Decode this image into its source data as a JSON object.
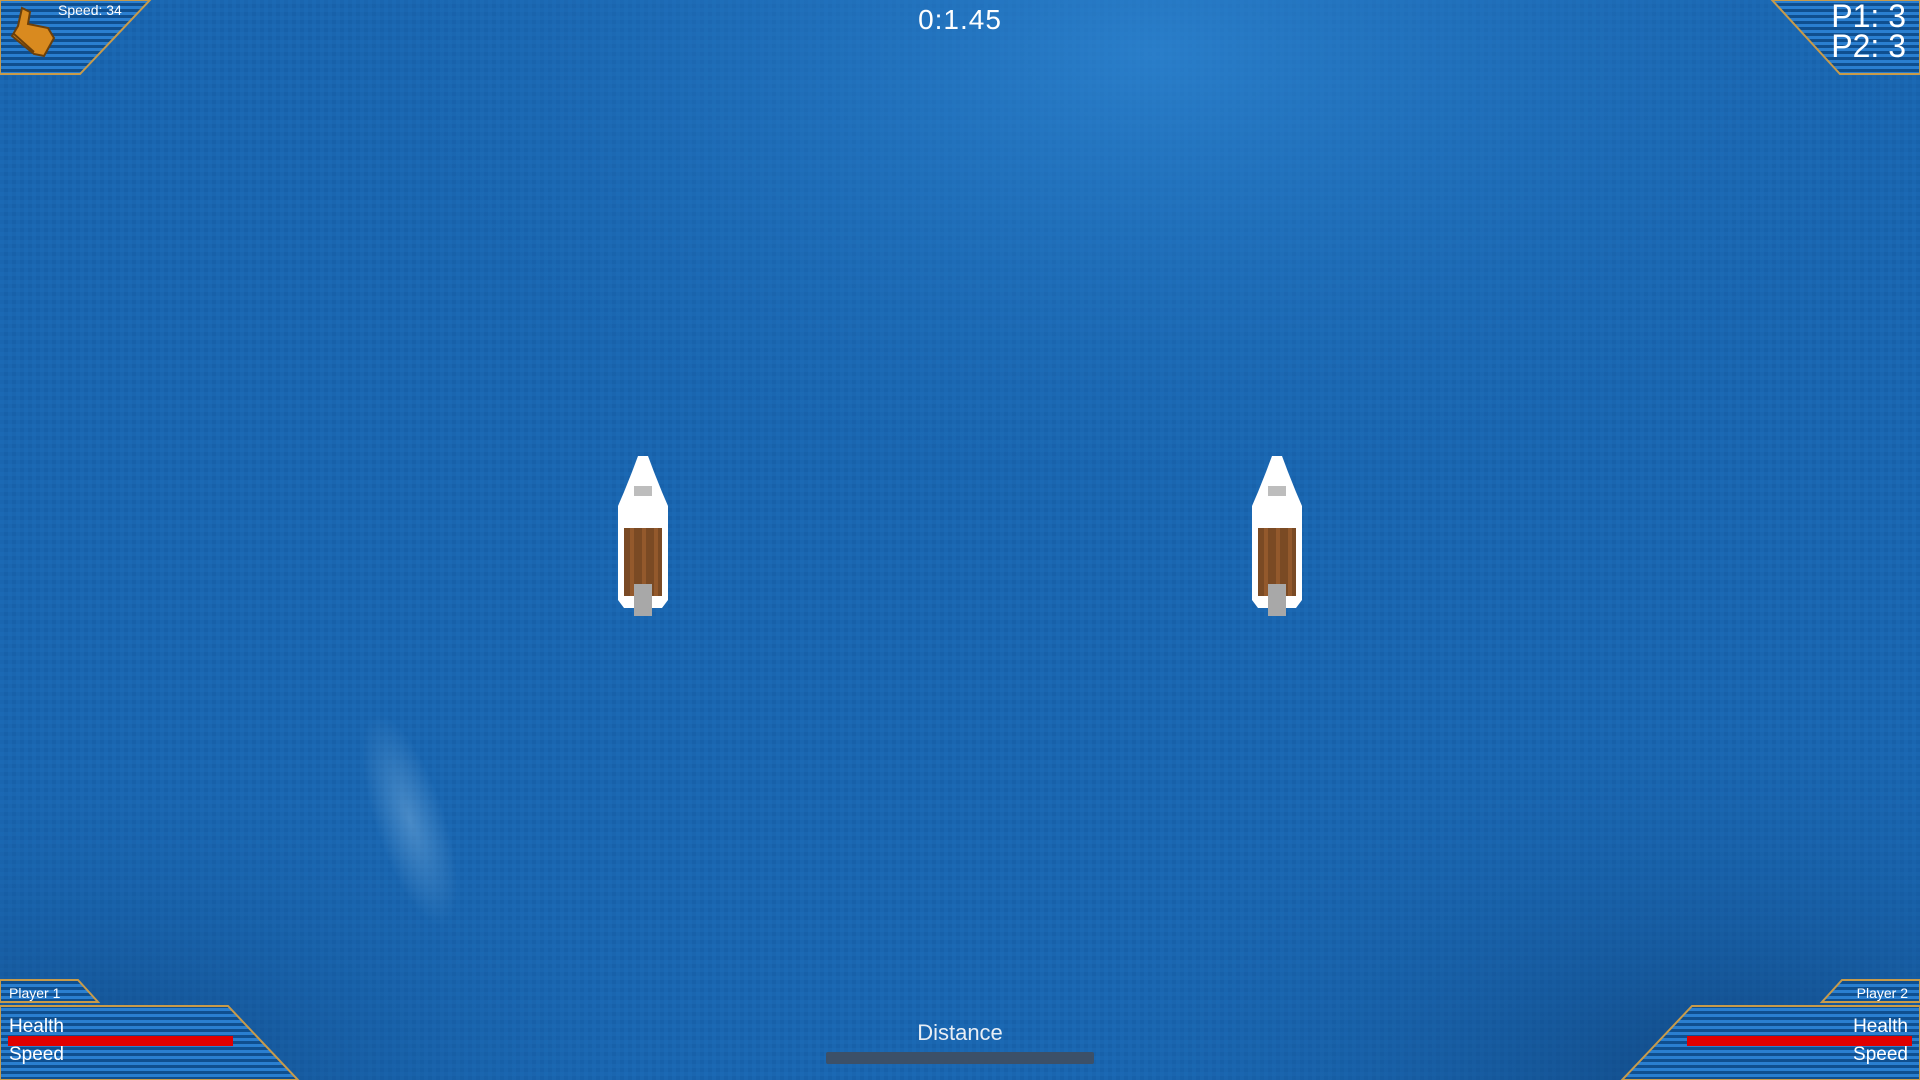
{
  "hud": {
    "timer": "0:1.45",
    "speed_label": "Speed: 34",
    "score": {
      "p1": "P1: 3",
      "p2": "P2: 3"
    },
    "distance_label": "Distance",
    "distance_fraction": 0.0
  },
  "players": [
    {
      "name": "Player 1",
      "health_label": "Health",
      "speed_label": "Speed",
      "health_fraction": 1.0
    },
    {
      "name": "Player 2",
      "health_label": "Health",
      "speed_label": "Speed",
      "health_fraction": 1.0
    }
  ],
  "icons": {
    "speed_indicator": "boot-icon",
    "boat": "boat-icon"
  },
  "colors": {
    "water": "#1a66b0",
    "panel_fill": "#0f4f8f",
    "panel_stripe": "#2a7fd0",
    "panel_border": "#c89b4a",
    "health": "#e00000",
    "boot": "#d98a1f",
    "boat_hull": "#ffffff",
    "boat_deck": "#7a4a24"
  }
}
